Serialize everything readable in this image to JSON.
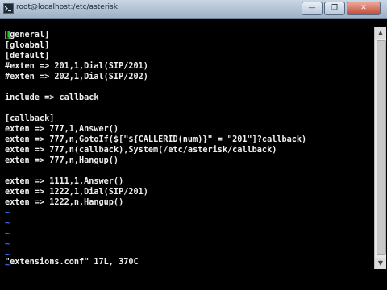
{
  "window": {
    "title": "root@localhost:/etc/asterisk",
    "minimize_label": "—",
    "maximize_label": "❐",
    "close_label": "✕"
  },
  "terminal": {
    "cursor_char": "[",
    "lines": [
      "general]",
      "[gloabal]",
      "[default]",
      "#exten => 201,1,Dial(SIP/201)",
      "#exten => 202,1,Dial(SIP/202)",
      "",
      "include => callback",
      "",
      "[callback]",
      "exten => 777,1,Answer()",
      "exten => 777,n,GotoIf($[\"${CALLERID(num)}\" = \"201\"]?callback)",
      "exten => 777,n(callback),System(/etc/asterisk/callback)",
      "exten => 777,n,Hangup()",
      "",
      "exten => 1111,1,Answer()",
      "exten => 1222,1,Dial(SIP/201)",
      "exten => 1222,n,Hangup()"
    ],
    "tilde": "~",
    "status_line": "\"extensions.conf\" 17L, 370C"
  },
  "scrollbar": {
    "up_icon": "scroll-up-arrow",
    "down_icon": "scroll-down-arrow"
  }
}
